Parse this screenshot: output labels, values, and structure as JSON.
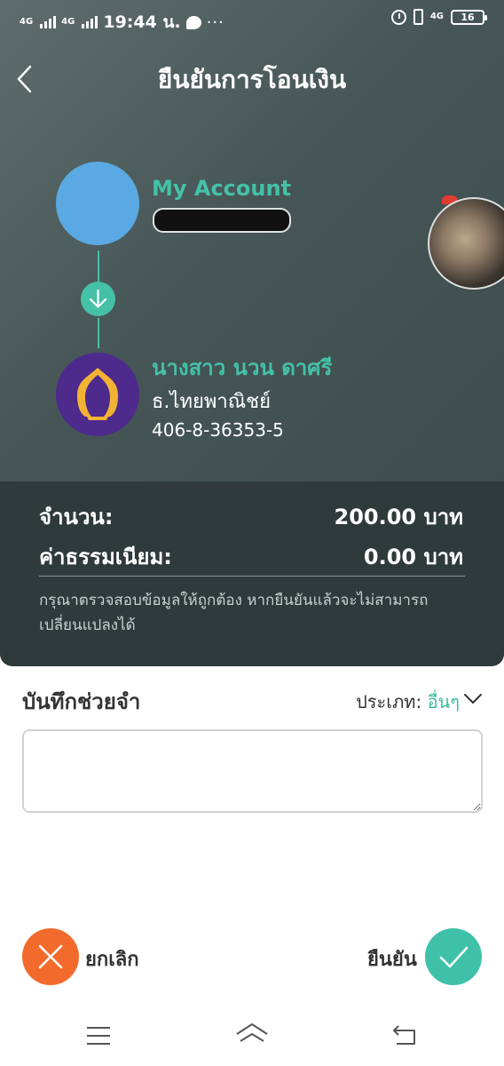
{
  "status_bar": {
    "network1": "4G",
    "network2": "4G",
    "time": "19:44 น.",
    "dots": "···",
    "network3": "4G",
    "battery": "16"
  },
  "header": {
    "title": "ยืนยันการโอนเงิน"
  },
  "sender": {
    "name": "My Account"
  },
  "recipient": {
    "name": "นางสาว นวน ดาศรี",
    "bank": "ธ.ไทยพาณิชย์",
    "account_number": "406-8-36353-5"
  },
  "summary": {
    "amount_label": "จำนวน:",
    "amount_value": "200.00  บาท",
    "fee_label": "ค่าธรรมเนียม:",
    "fee_value": "0.00  บาท",
    "warning": "กรุณาตรวจสอบข้อมูลให้ถูกต้อง หากยืนยันแล้วจะไม่สามารถเปลี่ยนแปลงได้"
  },
  "memo": {
    "title": "บันทึกช่วยจำ",
    "type_label": "ประเภท:",
    "type_value": "อื่นๆ",
    "value": ""
  },
  "actions": {
    "cancel_label": "ยกเลิก",
    "confirm_label": "ยืนยัน"
  },
  "colors": {
    "accent": "#45c1a7",
    "cancel": "#f26b2c",
    "bank_purple": "#4d2a8c",
    "bank_gold": "#f2b233"
  }
}
